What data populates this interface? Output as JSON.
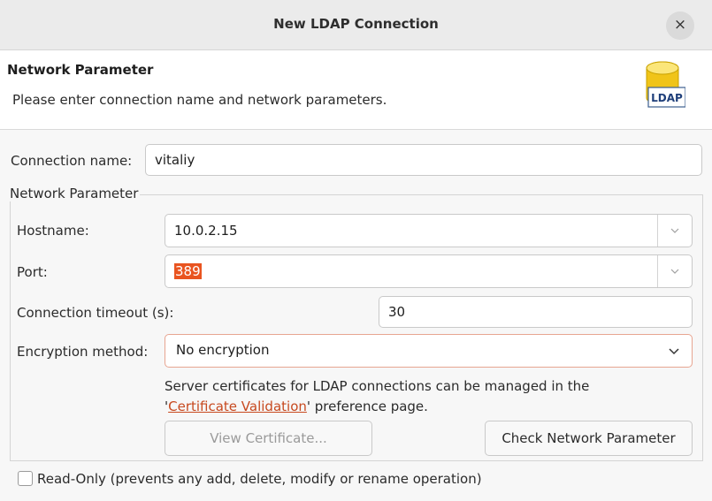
{
  "window": {
    "title": "New LDAP Connection",
    "close_glyph": "×"
  },
  "header": {
    "title": "Network Parameter",
    "description": "Please enter connection name and network parameters.",
    "icon_text": "LDAP"
  },
  "form": {
    "connection_name_label": "Connection name:",
    "connection_name_value": "vitaliy",
    "group_label": "Network Parameter",
    "hostname_label": "Hostname:",
    "hostname_value": "10.0.2.15",
    "port_label": "Port:",
    "port_value": "389",
    "timeout_label": "Connection timeout (s):",
    "timeout_value": "30",
    "encryption_label": "Encryption method:",
    "encryption_value": "No encryption",
    "note_line1": "Server certificates for LDAP connections can be managed in the",
    "note_quote_open": "'",
    "note_link": "Certificate Validation",
    "note_line2_rest": "' preference page.",
    "view_certificate_button": "View Certificate...",
    "check_network_button": "Check Network Parameter",
    "readonly_label": "Read-Only (prevents any add, delete, modify or rename operation)"
  },
  "colors": {
    "accent": "#e95420",
    "link": "#c7491f",
    "focus_border": "#e7a591"
  }
}
